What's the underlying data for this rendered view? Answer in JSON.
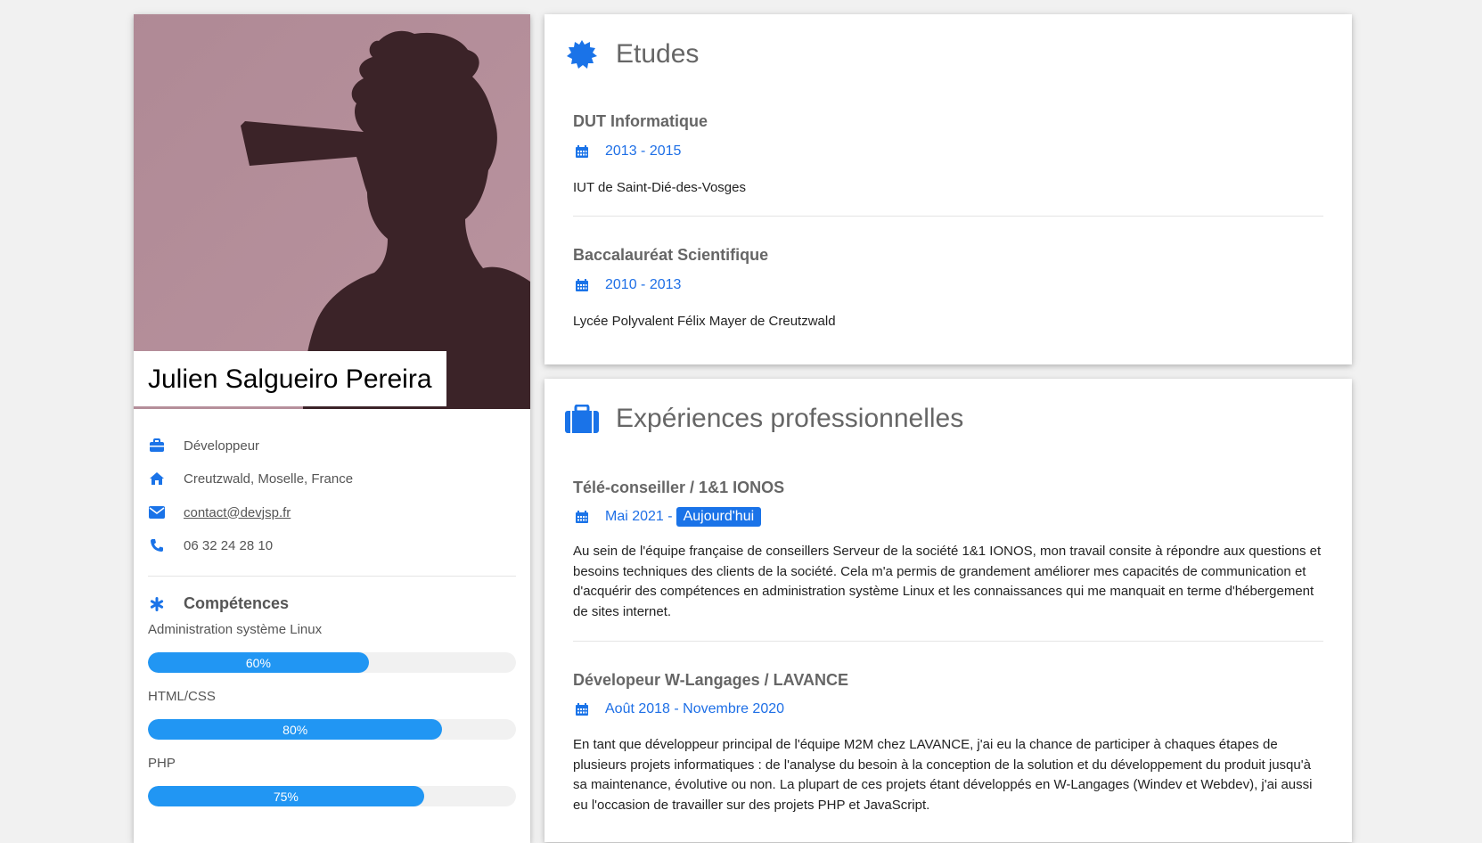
{
  "profile": {
    "name": "Julien Salgueiro Pereira",
    "photo_icon": "silhouette-portrait",
    "job": "Développeur",
    "location": "Creutzwald, Moselle, France",
    "email": "contact@devjsp.fr",
    "phone": "06 32 24 28 10"
  },
  "skills": {
    "title": "Compétences",
    "items": [
      {
        "label": "Administration système Linux",
        "level": 0.6,
        "display": "60%"
      },
      {
        "label": "HTML/CSS",
        "level": 0.8,
        "display": "80%"
      },
      {
        "label": "PHP",
        "level": 0.75,
        "display": "75%"
      }
    ]
  },
  "etudes": {
    "title": "Etudes",
    "entries": [
      {
        "title": "DUT Informatique",
        "date": "2013 - 2015",
        "place": "IUT de Saint-Dié-des-Vosges"
      },
      {
        "title": "Baccalauréat Scientifique",
        "date": "2010 - 2013",
        "place": "Lycée Polyvalent Félix Mayer de Creutzwald"
      }
    ]
  },
  "experiences": {
    "title": "Expériences professionnelles",
    "entries": [
      {
        "title": "Télé-conseiller / 1&1 IONOS",
        "date": "Mai 2021 -",
        "badge": "Aujourd'hui",
        "text": "Au sein de l'équipe française de conseillers Serveur de la société 1&1 IONOS, mon travail consite à répondre aux questions et besoins techniques des clients de la société. Cela m'a permis de grandement améliorer mes capacités de communication et d'acquérir des compétences en administration système Linux et les connaissances qui me manquait en terme d'hébergement de sites internet."
      },
      {
        "title": "Dévelopeur W-Langages / LAVANCE",
        "date": "Août 2018 - Novembre 2020",
        "text": "En tant que développeur principal de l'équipe M2M chez LAVANCE, j'ai eu la chance de participer à chaques étapes de plusieurs projets informatiques : de l'analyse du besoin à la conception de la solution et du développement du produit jusqu'à sa maintenance, évolutive ou non. La plupart de ces projets étant développés en W-Langages (Windev et Webdev), j'ai aussi eu l'occasion de travailler sur des projets PHP et JavaScript."
      }
    ]
  },
  "colors": {
    "accent": "#1a73e8",
    "bar": "#2196f3",
    "photo_bg": "#b08a96",
    "silhouette": "#3b2328"
  }
}
